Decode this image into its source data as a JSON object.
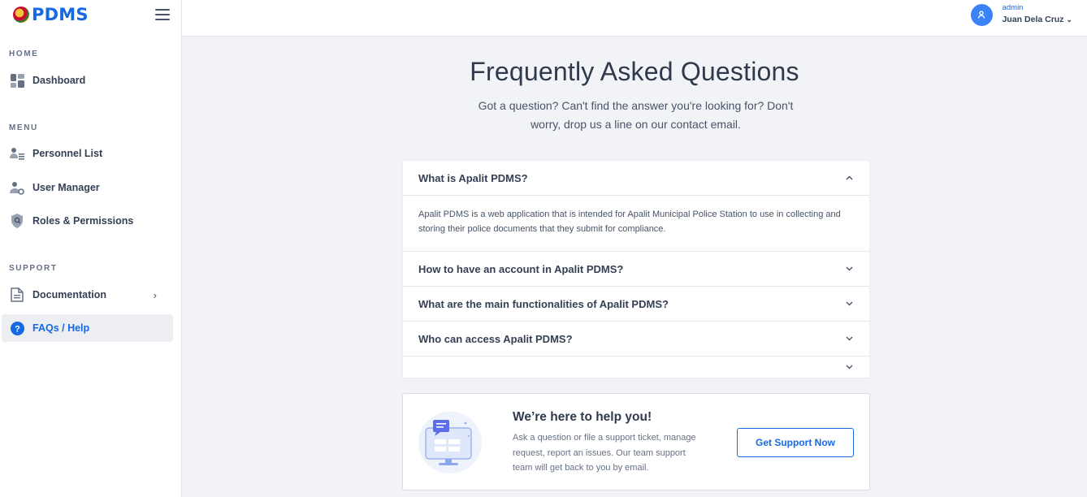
{
  "brand": {
    "name": "PDMS"
  },
  "sidebar": {
    "sections": {
      "home": "HOME",
      "menu": "MENU",
      "support": "SUPPORT"
    },
    "items": [
      {
        "label": "Dashboard",
        "icon": "dashboard-icon"
      },
      {
        "label": "Personnel List",
        "icon": "personnel-list-icon"
      },
      {
        "label": "User Manager",
        "icon": "user-manager-icon"
      },
      {
        "label": "Roles & Permissions",
        "icon": "shield-icon"
      },
      {
        "label": "Documentation",
        "icon": "document-icon"
      },
      {
        "label": "FAQs / Help",
        "icon": "question-icon",
        "active": true
      }
    ]
  },
  "user": {
    "role": "admin",
    "name": "Juan Dela Cruz"
  },
  "faq": {
    "title": "Frequently Asked Questions",
    "subtitle": "Got a question? Can't find the answer you're looking for? Don't worry, drop us a line on our contact email.",
    "items": [
      {
        "question": "What is Apalit PDMS?",
        "answer": "Apalit PDMS is a web application that is intended for Apalit Municipal Police Station to use in collecting and storing their police documents that they submit for compliance.",
        "expanded": true
      },
      {
        "question": "How to have an account in Apalit PDMS?",
        "expanded": false
      },
      {
        "question": "What are the main functionalities of Apalit PDMS?",
        "expanded": false
      },
      {
        "question": "Who can access Apalit PDMS?",
        "expanded": false
      },
      {
        "question": "",
        "expanded": false
      }
    ]
  },
  "help": {
    "title": "We’re here to help you!",
    "text": "Ask a question or file a support ticket, manage request, report an issues. Our team support team will get back to you by email.",
    "button": "Get Support Now"
  },
  "colors": {
    "accent": "#1668e3",
    "avatar": "#3b82f6",
    "background": "#f1f3f7"
  }
}
